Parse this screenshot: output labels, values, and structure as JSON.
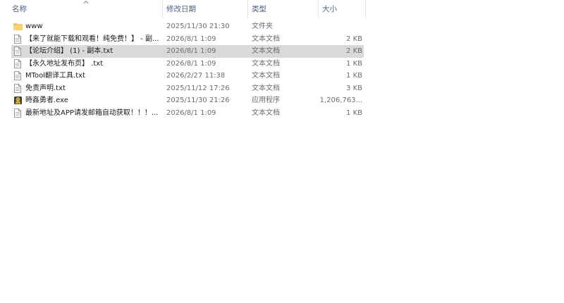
{
  "columns": {
    "name": "名称",
    "date": "修改日期",
    "type": "类型",
    "size": "大小"
  },
  "colors": {
    "folder": "#f6c445",
    "selection": "#d9d9d9",
    "header_text": "#4d6082"
  },
  "files": [
    {
      "icon": "folder-icon",
      "name": "www",
      "date": "2025/11/30 21:30",
      "type": "文件夹",
      "size": ""
    },
    {
      "icon": "text-file-icon",
      "name": "【来了就能下载和观看！纯免费！】 - 副...",
      "date": "2026/8/1 1:09",
      "type": "文本文档",
      "size": "2 KB"
    },
    {
      "icon": "text-file-icon",
      "name": "【论坛介绍】 (1) - 副本.txt",
      "date": "2026/8/1 1:09",
      "type": "文本文档",
      "size": "2 KB",
      "selected": true
    },
    {
      "icon": "text-file-icon",
      "name": "【永久地址发布页】 .txt",
      "date": "2026/8/1 1:09",
      "type": "文本文档",
      "size": "1 KB"
    },
    {
      "icon": "text-file-icon",
      "name": "MTool翻译工具.txt",
      "date": "2026/2/27 11:38",
      "type": "文本文档",
      "size": "1 KB"
    },
    {
      "icon": "text-file-icon",
      "name": "免责声明.txt",
      "date": "2025/11/12 17:26",
      "type": "文本文档",
      "size": "3 KB"
    },
    {
      "icon": "app-exe-icon",
      "name": "時姦勇者.exe",
      "date": "2025/11/30 21:26",
      "type": "应用程序",
      "size": "1,206,763..."
    },
    {
      "icon": "text-file-icon",
      "name": "最新地址及APP请发邮箱自动获取！！！...",
      "date": "2026/8/1 1:09",
      "type": "文本文档",
      "size": "1 KB"
    }
  ]
}
